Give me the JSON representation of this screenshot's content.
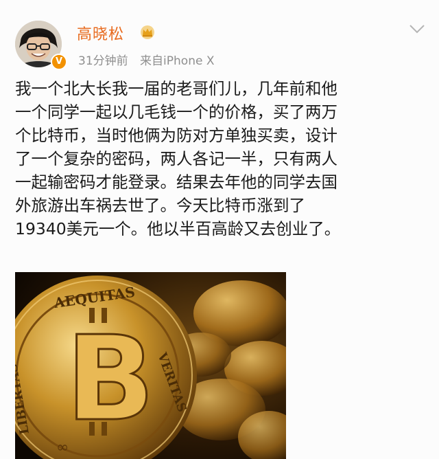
{
  "post": {
    "author": "高晓松",
    "time": "31分钟前",
    "source": "来自iPhone X",
    "content_lines": [
      "我一个北大长我一届的老哥们儿，几年前和他",
      "一个同学一起以几毛钱一个的价格，买了两万",
      "个比特币，当时他俩为防对方单独买卖，设计",
      "了一个复杂的密码，两人各记一半，只有两人",
      "一起输密码才能登录。结果去年他的同学去国",
      "外旅游出车祸去世了。今天比特币涨到了",
      "19340美元一个。他以半百高龄又去创业了。"
    ],
    "image": {
      "coin_text_top": "AEQUITAS",
      "coin_text_right": "VERITAS",
      "coin_text_left": "LIBERTAS",
      "coin_symbol": "B"
    }
  },
  "colors": {
    "username": "#e86b1f",
    "meta": "#8f8f8f",
    "verified_badge": "#f29100",
    "text": "#1b1b1b",
    "coin_gold": "#c8922a"
  },
  "icons": {
    "verified": "v-badge-icon",
    "crown": "crown-icon",
    "menu": "chevron-down-icon"
  }
}
